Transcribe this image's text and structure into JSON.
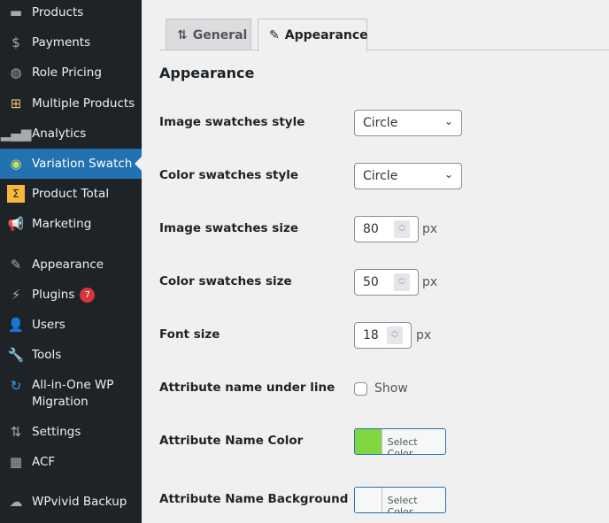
{
  "sidebar": {
    "items": [
      {
        "label": "Products",
        "icon": "archive-icon"
      },
      {
        "label": "Payments",
        "icon": "dollar-icon"
      },
      {
        "label": "Role Pricing",
        "icon": "role-pricing-icon"
      },
      {
        "label": "Multiple Products",
        "icon": "basket-icon"
      },
      {
        "label": "Analytics",
        "icon": "bar-chart-icon"
      },
      {
        "label": "Variation Swatch",
        "icon": "circle-target-icon",
        "active": true
      },
      {
        "label": "Product Total",
        "icon": "sigma-icon"
      },
      {
        "label": "Marketing",
        "icon": "megaphone-icon"
      },
      {
        "label": "Appearance",
        "icon": "paintbrush-icon"
      },
      {
        "label": "Plugins",
        "icon": "plug-icon",
        "badge": "7"
      },
      {
        "label": "Users",
        "icon": "user-icon"
      },
      {
        "label": "Tools",
        "icon": "wrench-icon"
      },
      {
        "label": "All-in-One WP Migration",
        "icon": "migration-icon"
      },
      {
        "label": "Settings",
        "icon": "sliders-icon"
      },
      {
        "label": "ACF",
        "icon": "table-icon"
      },
      {
        "label": "WPvivid Backup",
        "icon": "cloud-icon"
      }
    ]
  },
  "tabs": [
    {
      "label": "General",
      "icon": "sliders-icon"
    },
    {
      "label": "Appearance",
      "icon": "paintbrush-icon",
      "active": true
    }
  ],
  "section_title": "Appearance",
  "fields": {
    "image_style": {
      "label": "Image swatches style",
      "value": "Circle"
    },
    "color_style": {
      "label": "Color swatches style",
      "value": "Circle"
    },
    "image_size": {
      "label": "Image swatches size",
      "value": "80",
      "unit": "px"
    },
    "color_size": {
      "label": "Color swatches size",
      "value": "50",
      "unit": "px"
    },
    "font_size": {
      "label": "Font size",
      "value": "18",
      "unit": "px"
    },
    "underline": {
      "label": "Attribute name under line",
      "option": "Show",
      "checked": false
    },
    "name_color": {
      "label": "Attribute Name Color",
      "button": "Select Color",
      "color": "#81d742"
    },
    "name_bg": {
      "label": "Attribute Name Background",
      "button": "Select Color",
      "color": "#f6f7f7"
    }
  }
}
